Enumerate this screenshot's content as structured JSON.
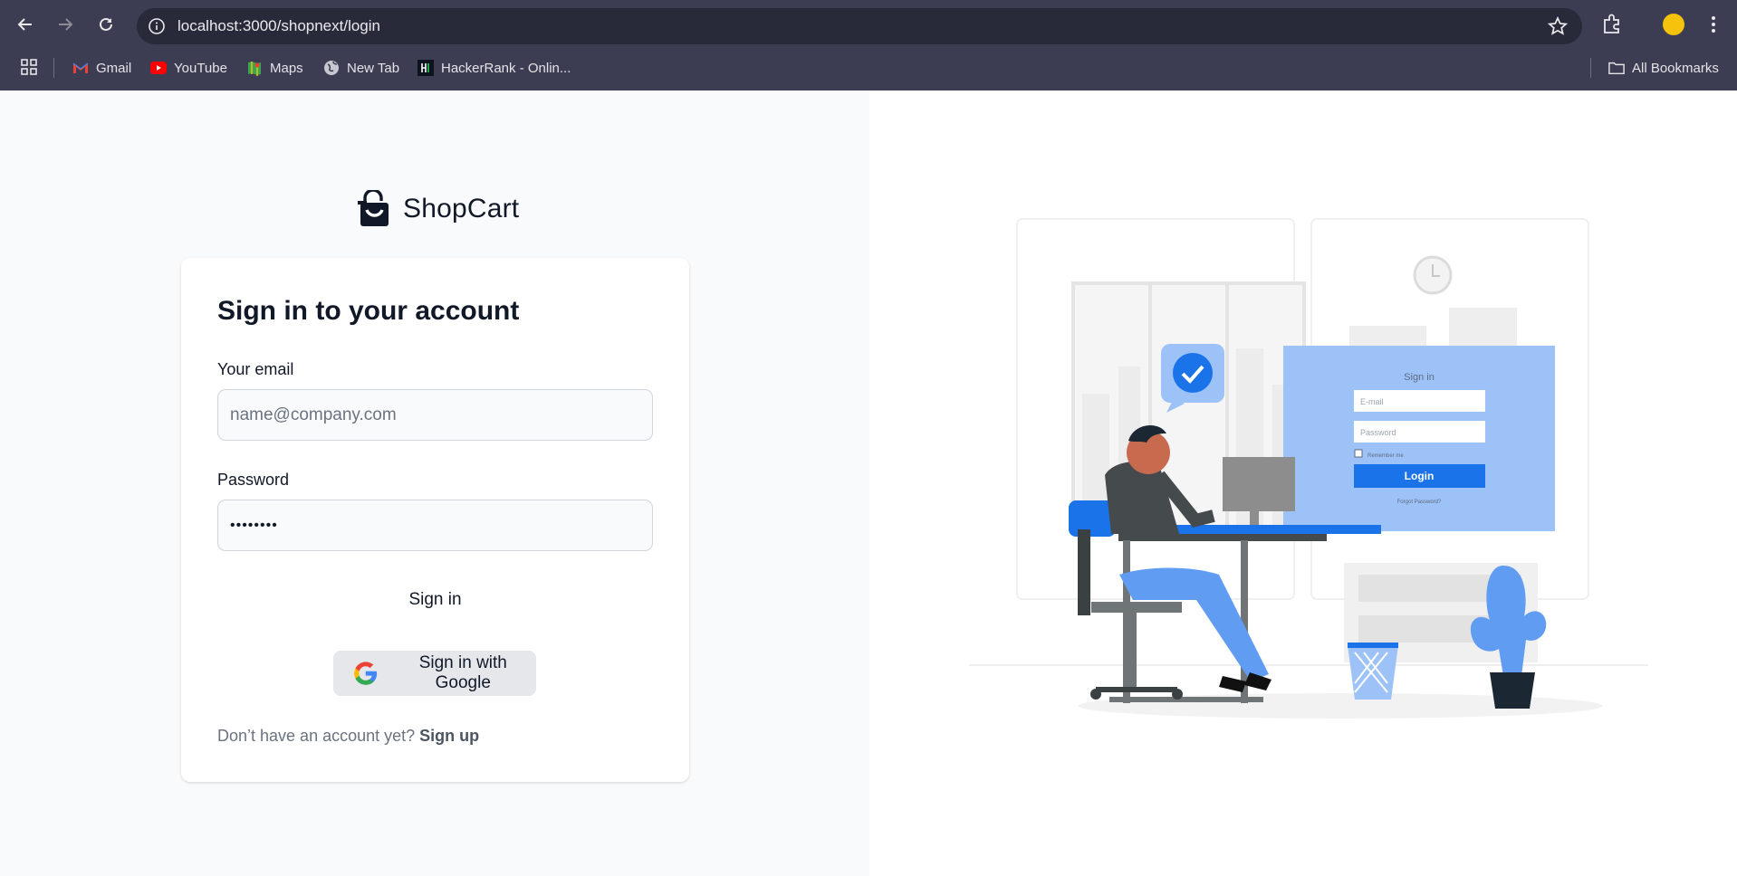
{
  "browser": {
    "url": "localhost:3000/shopnext/login",
    "bookmarks": [
      {
        "label": "Gmail",
        "icon": "gmail-icon"
      },
      {
        "label": "YouTube",
        "icon": "youtube-icon"
      },
      {
        "label": "Maps",
        "icon": "maps-icon"
      },
      {
        "label": "New Tab",
        "icon": "globe-icon"
      },
      {
        "label": "HackerRank - Onlin...",
        "icon": "hackerrank-icon"
      }
    ],
    "all_bookmarks": "All Bookmarks",
    "profile_color": "#f5c20c"
  },
  "brand": {
    "name": "ShopCart",
    "icon": "shopping-bag-icon"
  },
  "login": {
    "title": "Sign in to your account",
    "email_label": "Your email",
    "email_placeholder": "name@company.com",
    "email_value": "",
    "password_label": "Password",
    "password_value": "••••••••",
    "signin_label": "Sign in",
    "google_label": "Sign in with Google",
    "no_account_text": "Don’t have an account yet?",
    "signup_label": "Sign up"
  },
  "illustration": {
    "form_title": "Sign in",
    "email_placeholder": "E-mail",
    "password_placeholder": "Password",
    "remember_label": "Remember me",
    "login_label": "Login",
    "forgot_label": "Forgot Password?",
    "accent": "#1a73e8",
    "light_accent": "#9cc2f7"
  }
}
